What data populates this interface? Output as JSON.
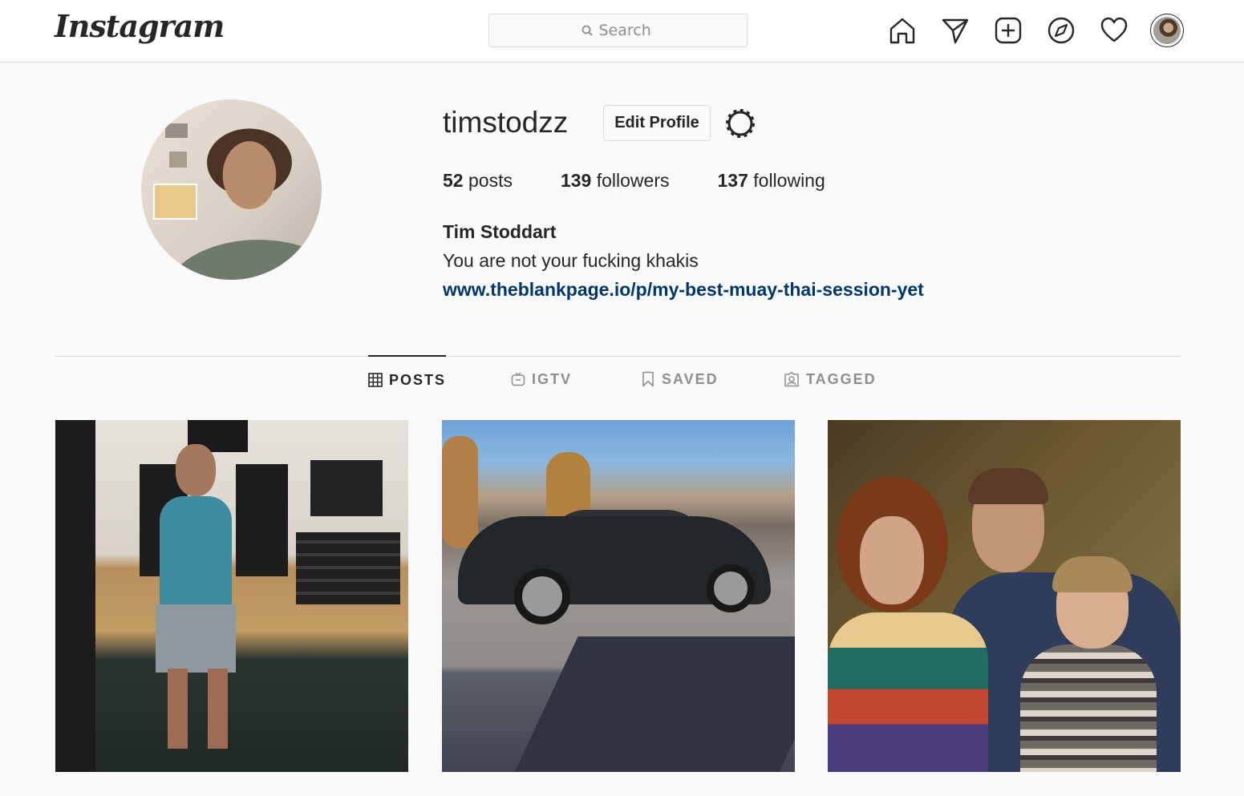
{
  "header": {
    "logo_text": "Instagram",
    "search_placeholder": "Search",
    "icons": [
      "home-icon",
      "direct-message-icon",
      "new-post-icon",
      "explore-icon",
      "activity-heart-icon",
      "profile-avatar"
    ]
  },
  "profile": {
    "username": "timstodzz",
    "edit_button_label": "Edit Profile",
    "stats": {
      "posts_count": "52",
      "posts_label": "posts",
      "followers_count": "139",
      "followers_label": "followers",
      "following_count": "137",
      "following_label": "following"
    },
    "full_name": "Tim Stoddart",
    "bio": "You are not your fucking khakis",
    "website": "www.theblankpage.io/p/my-best-muay-thai-session-yet"
  },
  "tabs": [
    {
      "label": "POSTS",
      "icon": "grid-icon",
      "active": true
    },
    {
      "label": "IGTV",
      "icon": "igtv-icon",
      "active": false
    },
    {
      "label": "SAVED",
      "icon": "bookmark-icon",
      "active": false
    },
    {
      "label": "TAGGED",
      "icon": "tagged-icon",
      "active": false
    }
  ],
  "posts": [
    "gym-mirror-selfie",
    "black-car-parking-lot",
    "family-photo"
  ],
  "colors": {
    "background": "#fafafa",
    "border": "#dbdbdb",
    "text": "#262626",
    "muted": "#8e8e8e",
    "link": "#00376b"
  }
}
